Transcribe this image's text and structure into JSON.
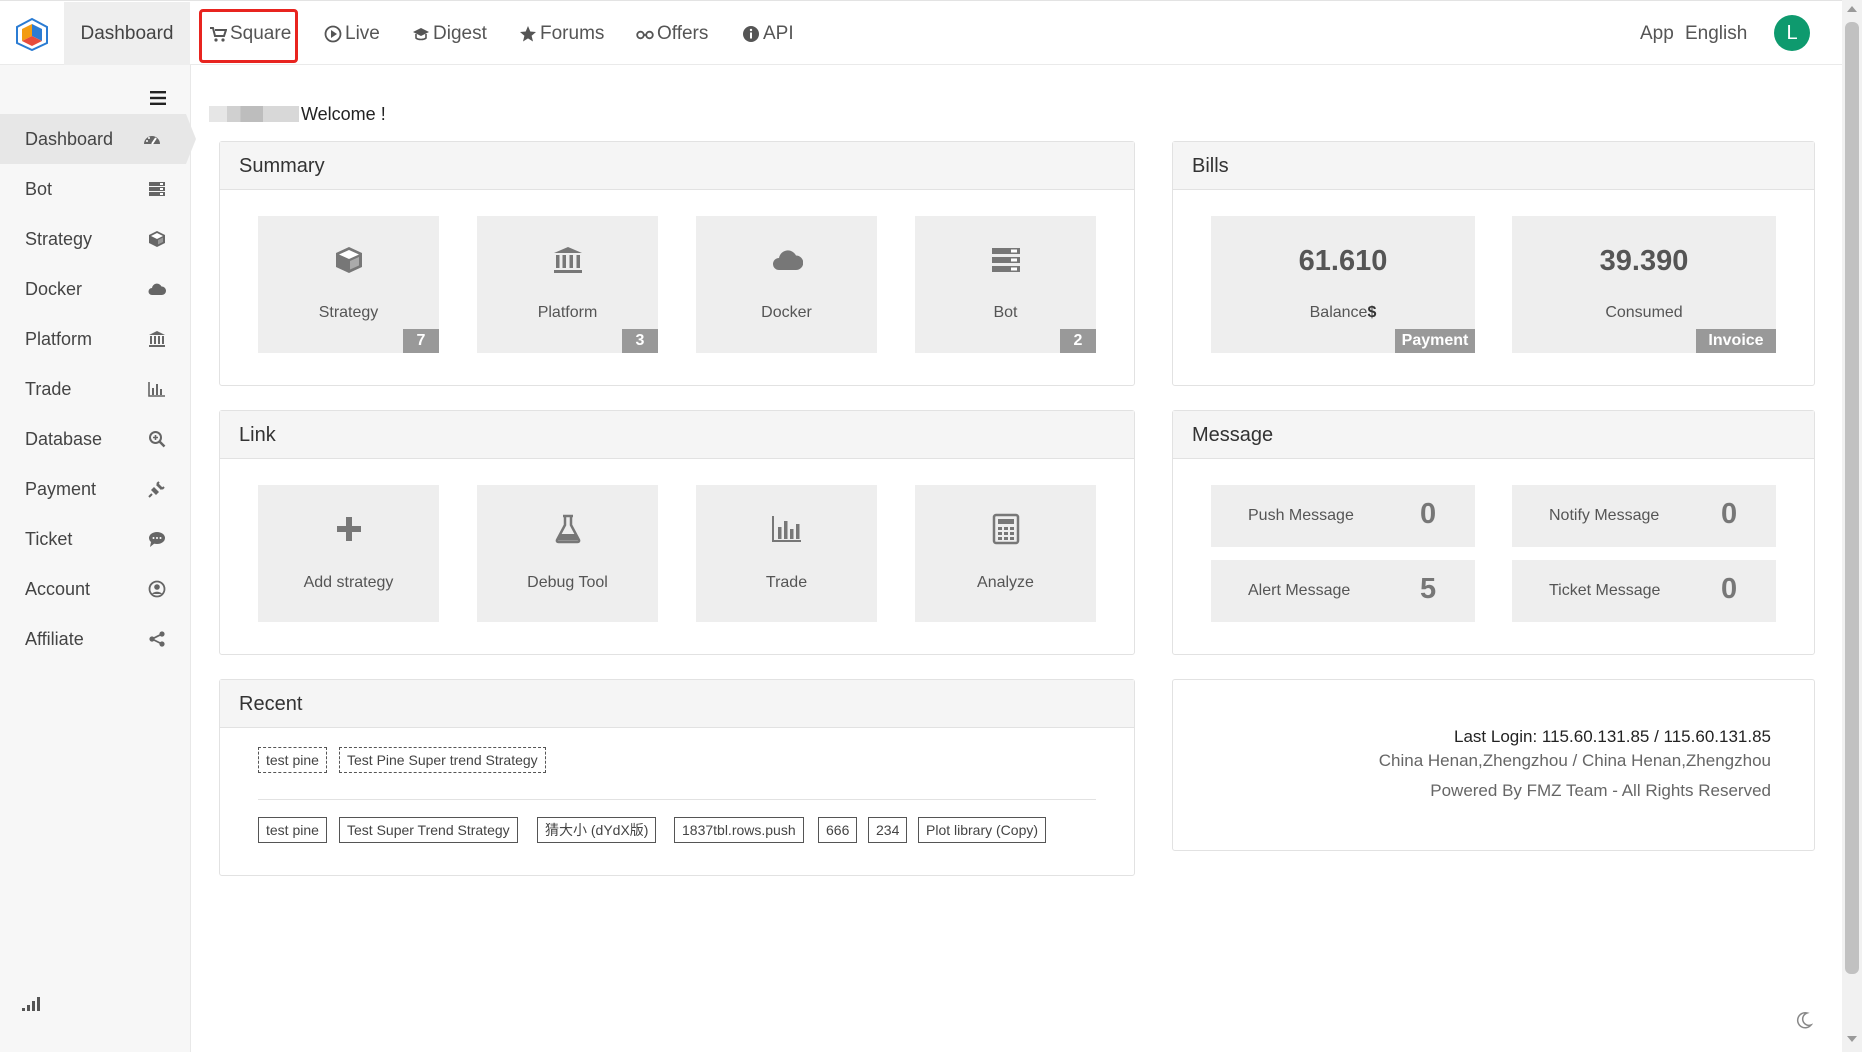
{
  "topbar": {
    "dashboard": "Dashboard",
    "nav": [
      {
        "label": "Square",
        "icon": "cart-icon"
      },
      {
        "label": "Live",
        "icon": "play-circle-icon"
      },
      {
        "label": "Digest",
        "icon": "graduation-cap-icon"
      },
      {
        "label": "Forums",
        "icon": "star-icon"
      },
      {
        "label": "Offers",
        "icon": "glasses-icon"
      },
      {
        "label": "API",
        "icon": "info-circle-icon"
      }
    ],
    "app": "App",
    "language": "English",
    "avatar_letter": "L",
    "highlight_color": "#e8241f"
  },
  "sidebar": {
    "items": [
      {
        "label": "Dashboard",
        "icon": "dashboard-gauge-icon"
      },
      {
        "label": "Bot",
        "icon": "server-icon"
      },
      {
        "label": "Strategy",
        "icon": "cube-icon"
      },
      {
        "label": "Docker",
        "icon": "cloud-icon"
      },
      {
        "label": "Platform",
        "icon": "bank-icon"
      },
      {
        "label": "Trade",
        "icon": "bar-chart-icon"
      },
      {
        "label": "Database",
        "icon": "search-plus-icon"
      },
      {
        "label": "Payment",
        "icon": "plug-icon"
      },
      {
        "label": "Ticket",
        "icon": "comment-icon"
      },
      {
        "label": "Account",
        "icon": "user-circle-icon"
      },
      {
        "label": "Affiliate",
        "icon": "share-icon"
      }
    ]
  },
  "welcome": "Welcome !",
  "summary": {
    "title": "Summary",
    "tiles": [
      {
        "label": "Strategy",
        "badge": "7",
        "icon": "cube-icon"
      },
      {
        "label": "Platform",
        "badge": "3",
        "icon": "bank-icon"
      },
      {
        "label": "Docker",
        "badge": "",
        "icon": "cloud-icon"
      },
      {
        "label": "Bot",
        "badge": "2",
        "icon": "server-icon"
      }
    ]
  },
  "bills": {
    "title": "Bills",
    "tiles": [
      {
        "value": "61.610",
        "label": "Balance",
        "label_suffix": "$",
        "badge": "Payment"
      },
      {
        "value": "39.390",
        "label": "Consumed",
        "label_suffix": "",
        "badge": "Invoice"
      }
    ]
  },
  "link": {
    "title": "Link",
    "tiles": [
      {
        "label": "Add strategy",
        "icon": "plus-icon"
      },
      {
        "label": "Debug Tool",
        "icon": "flask-icon"
      },
      {
        "label": "Trade",
        "icon": "bar-chart-icon"
      },
      {
        "label": "Analyze",
        "icon": "calculator-icon"
      }
    ]
  },
  "message": {
    "title": "Message",
    "tiles": [
      {
        "label": "Push Message",
        "value": "0"
      },
      {
        "label": "Notify Message",
        "value": "0"
      },
      {
        "label": "Alert Message",
        "value": "5"
      },
      {
        "label": "Ticket Message",
        "value": "0"
      }
    ]
  },
  "recent": {
    "title": "Recent",
    "row1": [
      "test pine",
      "Test Pine Super trend Strategy"
    ],
    "row2": [
      "test pine",
      "Test Super Trend Strategy",
      "猜大小 (dYdX版)",
      "1837tbl.rows.push",
      "666",
      "234",
      "Plot library (Copy)"
    ]
  },
  "login": {
    "last_login": "Last Login: 115.60.131.85 / 115.60.131.85",
    "location": "China Henan,Zhengzhou / China Henan,Zhengzhou",
    "powered": "Powered By FMZ Team - All Rights Reserved"
  }
}
